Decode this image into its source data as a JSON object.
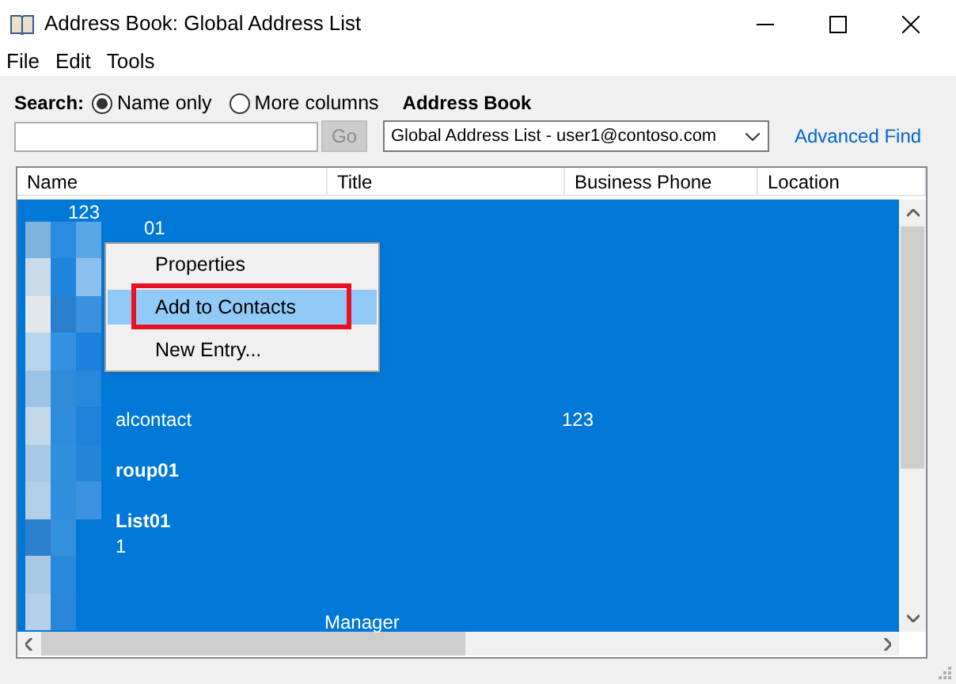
{
  "window": {
    "title": "Address Book: Global Address List"
  },
  "menu_bar": [
    "File",
    "Edit",
    "Tools"
  ],
  "search": {
    "label": "Search:",
    "options": [
      {
        "label": "Name only",
        "selected": true
      },
      {
        "label": "More columns",
        "selected": false
      }
    ],
    "go_button": "Go"
  },
  "address_book": {
    "label": "Address Book",
    "value": "Global Address List - user1@contoso.com"
  },
  "advanced_find": "Advanced Find",
  "table": {
    "columns": [
      "Name",
      "Title",
      "Business Phone",
      "Location"
    ],
    "rows": [
      {
        "name": "123",
        "bold": false
      },
      {
        "name": "01",
        "bold": false
      },
      {
        "name": "alcontact",
        "phone": "123",
        "bold": false
      },
      {
        "name": "roup01",
        "bold": true
      },
      {
        "name": "List01",
        "bold": true
      },
      {
        "name": "1",
        "bold": false
      },
      {
        "title": "Manager",
        "bold": false
      }
    ]
  },
  "context_menu": [
    {
      "label": "Properties",
      "selected": false,
      "outlined": false
    },
    {
      "label": "Add to Contacts",
      "selected": true,
      "outlined": true
    },
    {
      "label": "New Entry...",
      "selected": false,
      "outlined": false
    }
  ]
}
